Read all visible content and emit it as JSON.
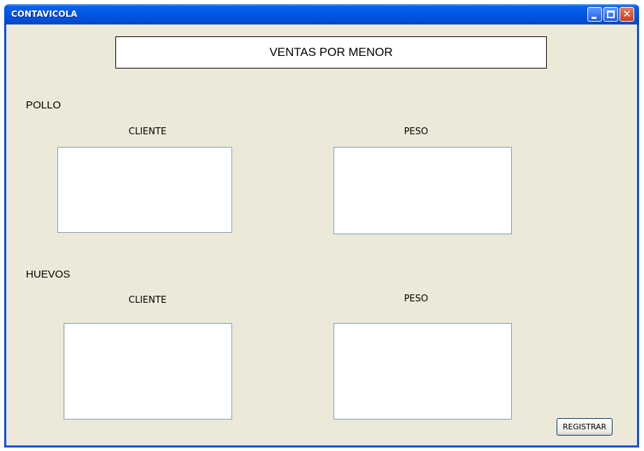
{
  "window": {
    "title": "CONTAVICOLA",
    "minimize_icon": "minimize-icon",
    "maximize_icon": "maximize-icon",
    "close_icon": "close-icon",
    "title_color": "#0058e6",
    "background_color": "#ece9d8"
  },
  "header": {
    "title": "VENTAS POR MENOR"
  },
  "sections": {
    "pollo": {
      "label": "POLLO",
      "cliente_label": "CLIENTE",
      "cliente_value": "",
      "peso_label": "PESO",
      "peso_value": ""
    },
    "huevos": {
      "label": "HUEVOS",
      "cliente_label": "CLIENTE",
      "cliente_value": "",
      "peso_label": "PESO",
      "peso_value": ""
    }
  },
  "actions": {
    "register_label": "REGISTRAR"
  }
}
